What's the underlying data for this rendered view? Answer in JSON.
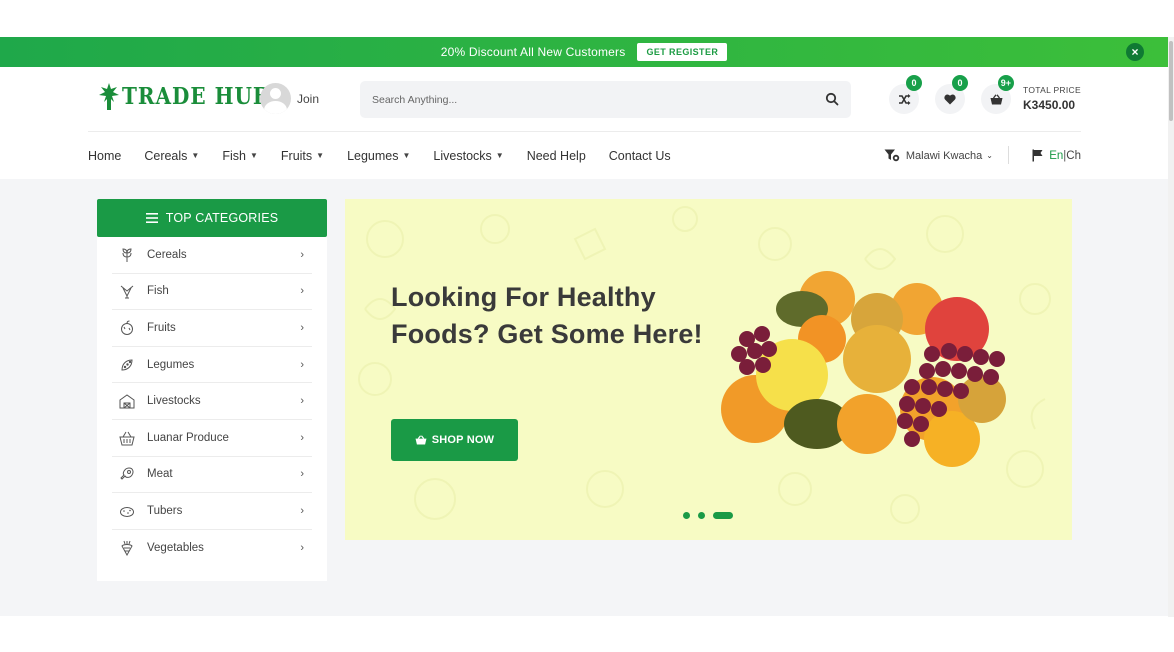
{
  "promo": {
    "text": "20% Discount All New Customers",
    "button": "GET REGISTER",
    "close": "×"
  },
  "header": {
    "logo": "TRADE HUB",
    "join": "Join",
    "search_placeholder": "Search Anything...",
    "compare_count": "0",
    "wishlist_count": "0",
    "cart_count": "9+",
    "total_label": "TOTAL PRICE",
    "total_value": "K3450.00"
  },
  "nav": {
    "items": [
      {
        "label": "Home",
        "dropdown": false
      },
      {
        "label": "Cereals",
        "dropdown": true
      },
      {
        "label": "Fish",
        "dropdown": true
      },
      {
        "label": "Fruits",
        "dropdown": true
      },
      {
        "label": "Legumes",
        "dropdown": true
      },
      {
        "label": "Livestocks",
        "dropdown": true
      },
      {
        "label": "Need Help",
        "dropdown": false
      },
      {
        "label": "Contact Us",
        "dropdown": false
      }
    ],
    "currency": "Malawi Kwacha",
    "lang_en": "En",
    "lang_sep": "|",
    "lang_ch": "Ch"
  },
  "sidebar": {
    "title": "TOP CATEGORIES",
    "categories": [
      {
        "label": "Cereals",
        "icon": "wheat-icon"
      },
      {
        "label": "Fish",
        "icon": "fish-icon"
      },
      {
        "label": "Fruits",
        "icon": "fruit-icon"
      },
      {
        "label": "Legumes",
        "icon": "legume-icon"
      },
      {
        "label": "Livestocks",
        "icon": "barn-icon"
      },
      {
        "label": "Luanar Produce",
        "icon": "basket-icon"
      },
      {
        "label": "Meat",
        "icon": "meat-icon"
      },
      {
        "label": "Tubers",
        "icon": "tuber-icon"
      },
      {
        "label": "Vegetables",
        "icon": "vegetable-icon"
      }
    ]
  },
  "banner": {
    "title": "Looking For Healthy Foods? Get Some Here!",
    "button": "SHOP NOW",
    "slides": 3,
    "active_slide": 3
  },
  "colors": {
    "brand": "#1a9a46",
    "banner_bg": "#f7fbc4",
    "page_bg": "#f4f5f7"
  }
}
